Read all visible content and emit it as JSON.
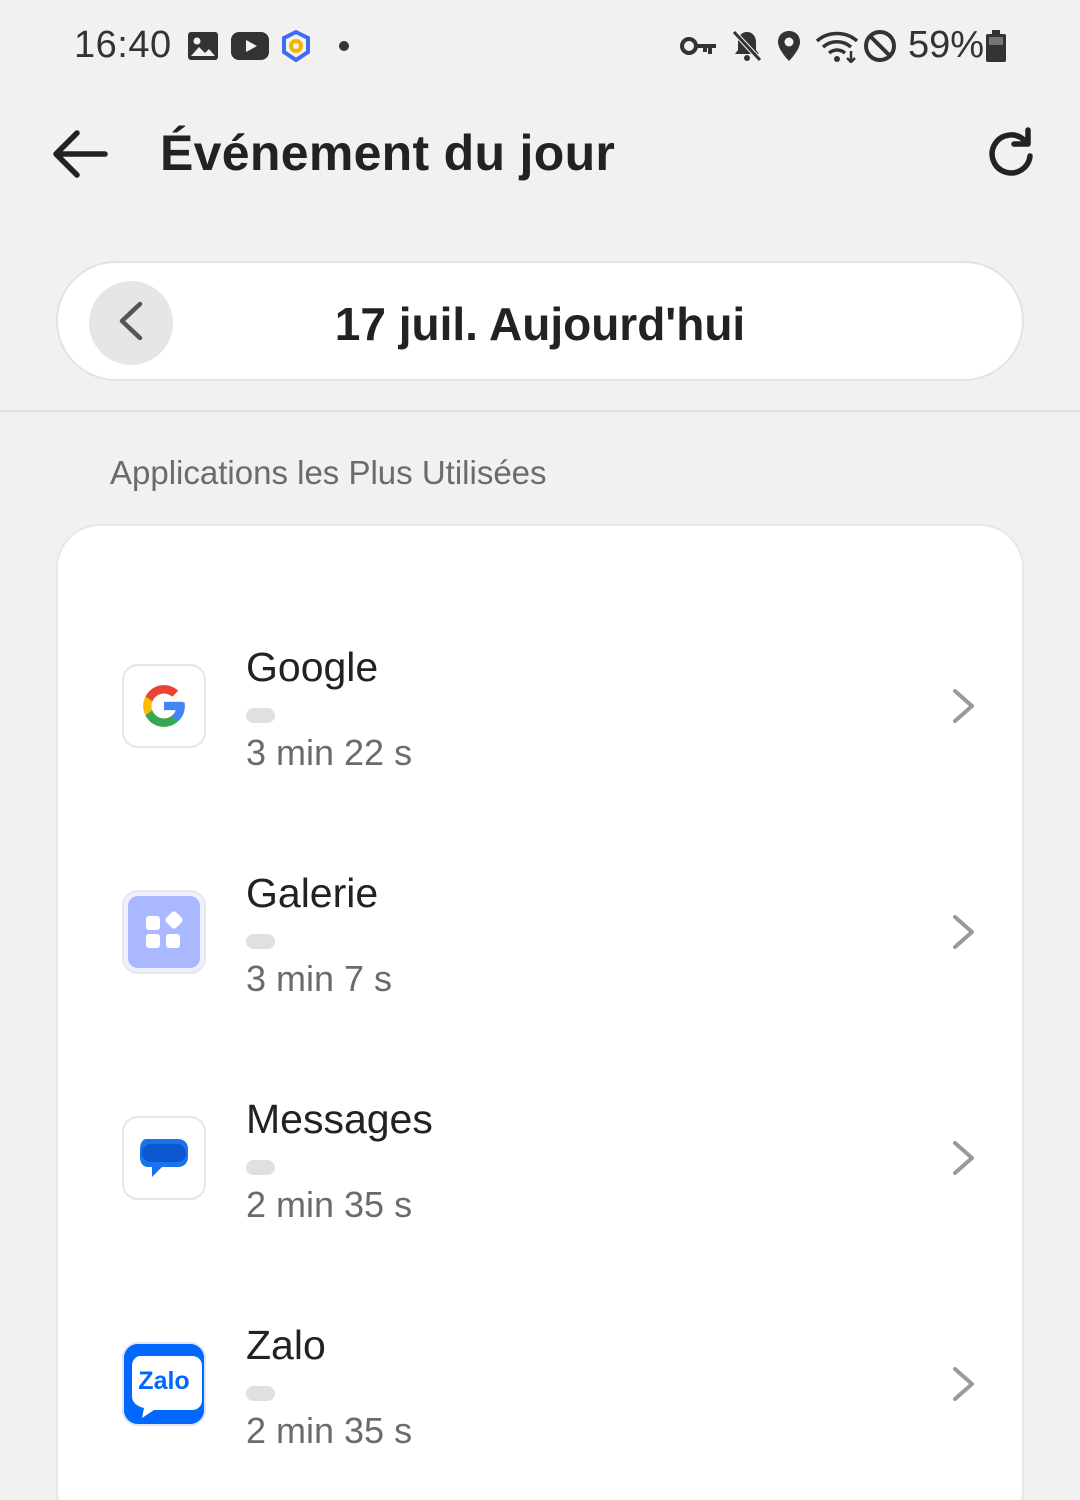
{
  "status_bar": {
    "time": "16:40",
    "battery_text": "59%",
    "icons_left": [
      "gallery-icon",
      "youtube-icon",
      "app-shield-icon",
      "notification-dot-icon"
    ],
    "icons_right": [
      "vpn-key-icon",
      "mute-icon",
      "location-icon",
      "wifi-icon",
      "do-not-disturb-icon",
      "battery-icon"
    ]
  },
  "header": {
    "title": "Événement du jour",
    "back_icon": "arrow-left-icon",
    "refresh_icon": "refresh-icon"
  },
  "date_selector": {
    "label": "17 juil. Aujourd'hui",
    "prev_icon": "chevron-left-icon"
  },
  "section": {
    "title": "Applications les Plus Utilisées"
  },
  "apps": [
    {
      "name": "Google",
      "time": "3 min 22 s",
      "icon": "google-icon"
    },
    {
      "name": "Galerie",
      "time": "3 min 7 s",
      "icon": "gallery-app-icon"
    },
    {
      "name": "Messages",
      "time": "2 min 35 s",
      "icon": "messages-icon"
    },
    {
      "name": "Zalo",
      "time": "2 min 35 s",
      "icon": "zalo-icon",
      "icon_text": "Zalo"
    }
  ],
  "colors": {
    "background": "#f1f1f1",
    "card": "#ffffff",
    "google_blue": "#4285F4",
    "google_red": "#EA4335",
    "google_yellow": "#FBBC05",
    "google_green": "#34A853",
    "gallery": "#a9b8ff",
    "messages_blue": "#1a73e8",
    "zalo_blue": "#0068ff"
  }
}
